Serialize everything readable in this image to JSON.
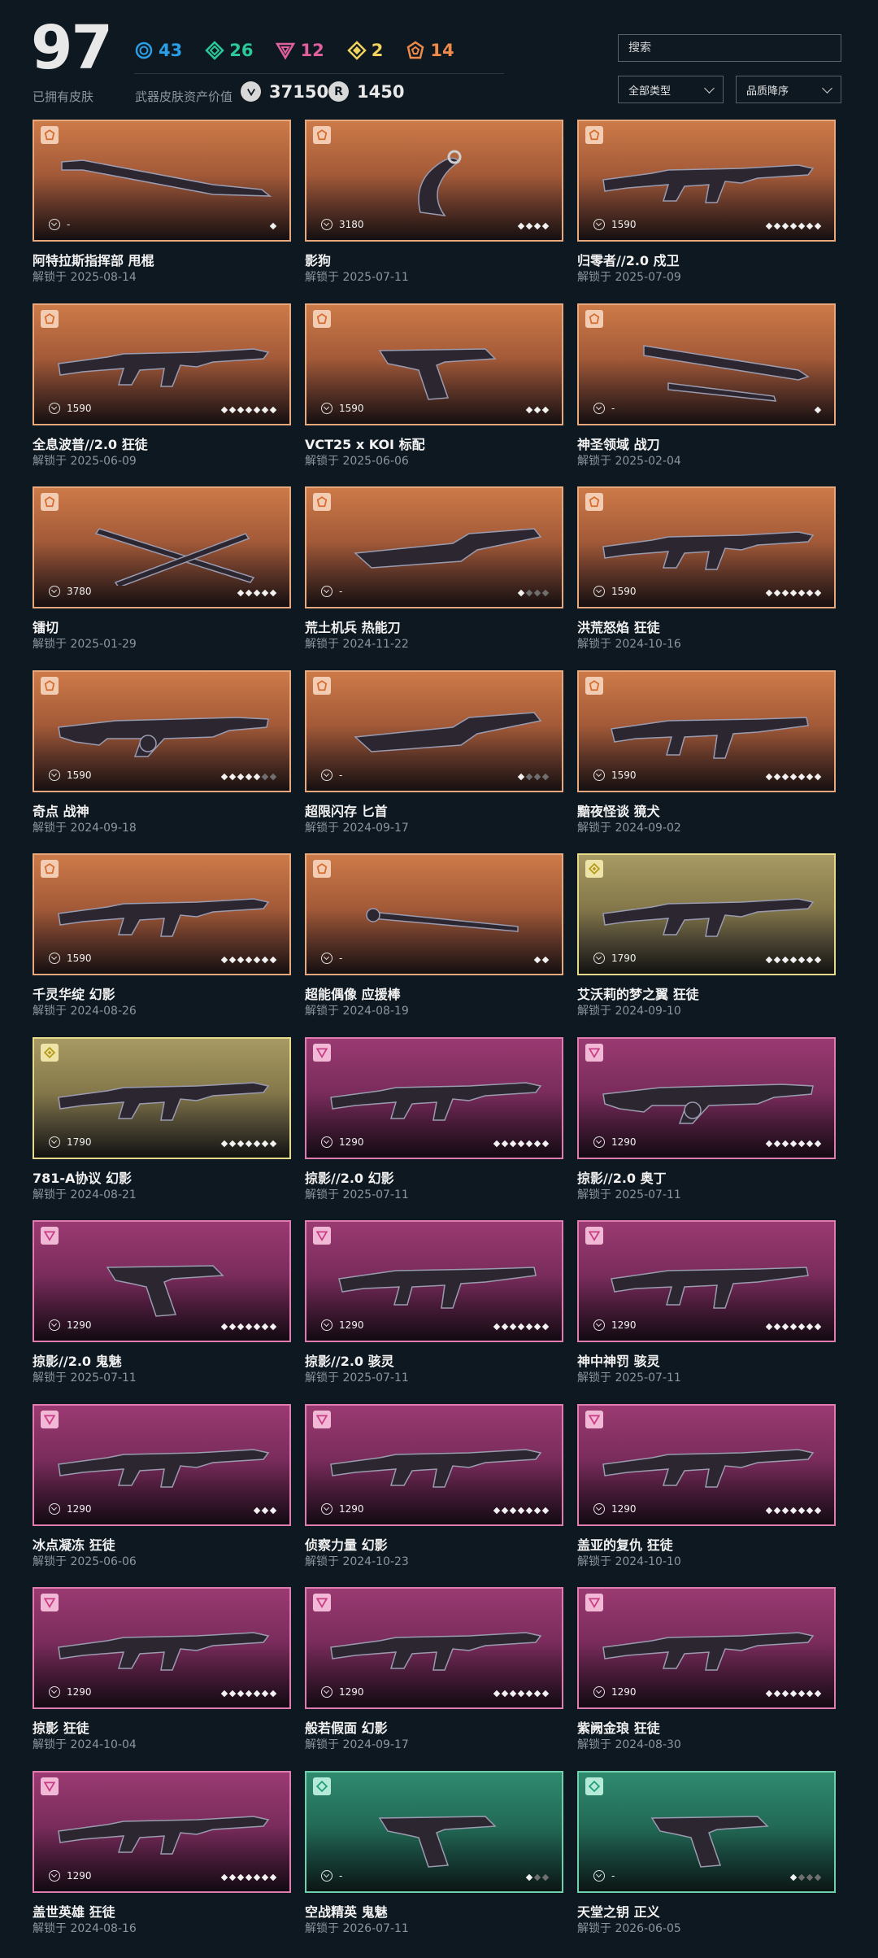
{
  "header": {
    "owned_count": "97",
    "owned_label": "已拥有皮肤",
    "tiers": [
      {
        "icon": "select-tier-icon",
        "count": "43",
        "color": "#2a9fe8"
      },
      {
        "icon": "deluxe-tier-icon",
        "count": "26",
        "color": "#2bc99a"
      },
      {
        "icon": "premium-tier-icon",
        "count": "12",
        "color": "#e0609e"
      },
      {
        "icon": "exclusive-tier-icon",
        "count": "2",
        "color": "#f0d25e"
      },
      {
        "icon": "ultra-tier-icon",
        "count": "14",
        "color": "#f08a4b"
      }
    ],
    "value_label": "武器皮肤资产价值",
    "vp_value": "37150",
    "rp_icon_text": "R",
    "rp_value": "1450"
  },
  "controls": {
    "search_placeholder": "搜索",
    "type_filter": "全部类型",
    "sort": "品质降序"
  },
  "skins": [
    {
      "name": "阿特拉斯指挥部 甩棍",
      "date": "解锁于 2025-08-14",
      "price": "-",
      "tier": "orange",
      "levels": 1,
      "levels_on": 1,
      "weapon": "melee-baton"
    },
    {
      "name": "影狗",
      "date": "解锁于 2025-07-11",
      "price": "3180",
      "tier": "orange",
      "levels": 4,
      "levels_on": 4,
      "weapon": "karambit"
    },
    {
      "name": "归零者//2.0 戍卫",
      "date": "解锁于 2025-07-09",
      "price": "1590",
      "tier": "orange",
      "levels": 7,
      "levels_on": 7,
      "weapon": "rifle"
    },
    {
      "name": "全息波普//2.0 狂徒",
      "date": "解锁于 2025-06-09",
      "price": "1590",
      "tier": "orange",
      "levels": 7,
      "levels_on": 7,
      "weapon": "rifle"
    },
    {
      "name": "VCT25 x KOI 标配",
      "date": "解锁于 2025-06-06",
      "price": "1590",
      "tier": "orange",
      "levels": 3,
      "levels_on": 3,
      "weapon": "pistol"
    },
    {
      "name": "神圣领域 战刀",
      "date": "解锁于 2025-02-04",
      "price": "-",
      "tier": "orange",
      "levels": 1,
      "levels_on": 1,
      "weapon": "blade"
    },
    {
      "name": "镭切",
      "date": "解锁于 2025-01-29",
      "price": "3780",
      "tier": "orange",
      "levels": 5,
      "levels_on": 5,
      "weapon": "katana"
    },
    {
      "name": "荒土机兵 热能刀",
      "date": "解锁于 2024-11-22",
      "price": "-",
      "tier": "orange",
      "levels": 4,
      "levels_on": 1,
      "weapon": "knife"
    },
    {
      "name": "洪荒怒焰 狂徒",
      "date": "解锁于 2024-10-16",
      "price": "1590",
      "tier": "orange",
      "levels": 7,
      "levels_on": 7,
      "weapon": "rifle"
    },
    {
      "name": "奇点 战神",
      "date": "解锁于 2024-09-18",
      "price": "1590",
      "tier": "orange",
      "levels": 7,
      "levels_on": 5,
      "weapon": "mg"
    },
    {
      "name": "超限闪存 匕首",
      "date": "解锁于 2024-09-17",
      "price": "-",
      "tier": "orange",
      "levels": 4,
      "levels_on": 1,
      "weapon": "knife"
    },
    {
      "name": "黯夜怪谈 獍犬",
      "date": "解锁于 2024-09-02",
      "price": "1590",
      "tier": "orange",
      "levels": 7,
      "levels_on": 7,
      "weapon": "smg"
    },
    {
      "name": "千灵华绽 幻影",
      "date": "解锁于 2024-08-26",
      "price": "1590",
      "tier": "orange",
      "levels": 7,
      "levels_on": 7,
      "weapon": "rifle"
    },
    {
      "name": "超能偶像 应援棒",
      "date": "解锁于 2024-08-19",
      "price": "-",
      "tier": "orange",
      "levels": 2,
      "levels_on": 2,
      "weapon": "baton"
    },
    {
      "name": "艾沃莉的梦之翼 狂徒",
      "date": "解锁于 2024-09-10",
      "price": "1790",
      "tier": "gold",
      "levels": 7,
      "levels_on": 7,
      "weapon": "rifle"
    },
    {
      "name": "781-A协议 幻影",
      "date": "解锁于 2024-08-21",
      "price": "1790",
      "tier": "gold",
      "levels": 7,
      "levels_on": 7,
      "weapon": "rifle"
    },
    {
      "name": "掠影//2.0 幻影",
      "date": "解锁于 2025-07-11",
      "price": "1290",
      "tier": "pink",
      "levels": 7,
      "levels_on": 7,
      "weapon": "rifle"
    },
    {
      "name": "掠影//2.0 奥丁",
      "date": "解锁于 2025-07-11",
      "price": "1290",
      "tier": "pink",
      "levels": 7,
      "levels_on": 7,
      "weapon": "mg"
    },
    {
      "name": "掠影//2.0 鬼魅",
      "date": "解锁于 2025-07-11",
      "price": "1290",
      "tier": "pink",
      "levels": 7,
      "levels_on": 7,
      "weapon": "pistol"
    },
    {
      "name": "掠影//2.0 骇灵",
      "date": "解锁于 2025-07-11",
      "price": "1290",
      "tier": "pink",
      "levels": 7,
      "levels_on": 7,
      "weapon": "smg"
    },
    {
      "name": "神中神罚 骇灵",
      "date": "解锁于 2025-07-11",
      "price": "1290",
      "tier": "pink",
      "levels": 7,
      "levels_on": 7,
      "weapon": "smg"
    },
    {
      "name": "冰点凝冻 狂徒",
      "date": "解锁于 2025-06-06",
      "price": "1290",
      "tier": "pink",
      "levels": 3,
      "levels_on": 3,
      "weapon": "rifle"
    },
    {
      "name": "侦察力量 幻影",
      "date": "解锁于 2024-10-23",
      "price": "1290",
      "tier": "pink",
      "levels": 7,
      "levels_on": 7,
      "weapon": "rifle"
    },
    {
      "name": "盖亚的复仇 狂徒",
      "date": "解锁于 2024-10-10",
      "price": "1290",
      "tier": "pink",
      "levels": 7,
      "levels_on": 7,
      "weapon": "rifle"
    },
    {
      "name": "掠影 狂徒",
      "date": "解锁于 2024-10-04",
      "price": "1290",
      "tier": "pink",
      "levels": 7,
      "levels_on": 7,
      "weapon": "rifle"
    },
    {
      "name": "般若假面 幻影",
      "date": "解锁于 2024-09-17",
      "price": "1290",
      "tier": "pink",
      "levels": 7,
      "levels_on": 7,
      "weapon": "rifle"
    },
    {
      "name": "紫阙金琅 狂徒",
      "date": "解锁于 2024-08-30",
      "price": "1290",
      "tier": "pink",
      "levels": 7,
      "levels_on": 7,
      "weapon": "rifle"
    },
    {
      "name": "盖世英雄 狂徒",
      "date": "解锁于 2024-08-16",
      "price": "1290",
      "tier": "pink",
      "levels": 7,
      "levels_on": 7,
      "weapon": "rifle"
    },
    {
      "name": "空战精英 鬼魅",
      "date": "解锁于 2026-07-11",
      "price": "-",
      "tier": "green",
      "levels": 3,
      "levels_on": 1,
      "weapon": "pistol"
    },
    {
      "name": "天堂之钥 正义",
      "date": "解锁于 2026-06-05",
      "price": "-",
      "tier": "green",
      "levels": 4,
      "levels_on": 1,
      "weapon": "pistol"
    }
  ]
}
